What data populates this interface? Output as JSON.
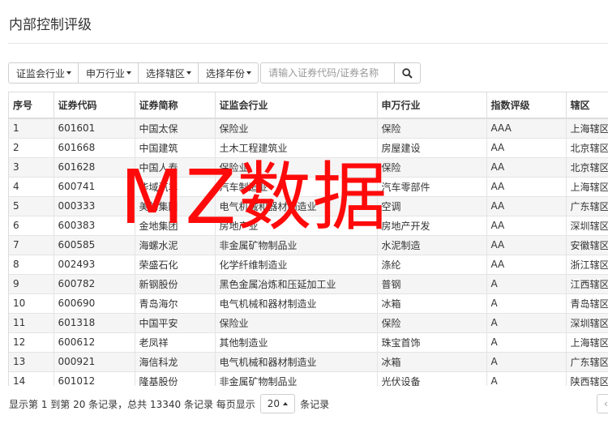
{
  "page": {
    "title": "内部控制评级"
  },
  "filters": [
    {
      "label": "证监会行业"
    },
    {
      "label": "申万行业"
    },
    {
      "label": "选择辖区"
    },
    {
      "label": "选择年份"
    }
  ],
  "search": {
    "placeholder": "请输入证券代码/证券名称",
    "value": ""
  },
  "table": {
    "columns": [
      "序号",
      "证券代码",
      "证券简称",
      "证监会行业",
      "申万行业",
      "指数评级",
      "辖区"
    ],
    "rows": [
      [
        "1",
        "601601",
        "中国太保",
        "保险业",
        "保险",
        "AAA",
        "上海辖区"
      ],
      [
        "2",
        "601668",
        "中国建筑",
        "土木工程建筑业",
        "房屋建设",
        "AA",
        "北京辖区"
      ],
      [
        "3",
        "601628",
        "中国人寿",
        "保险业",
        "保险",
        "AA",
        "北京辖区"
      ],
      [
        "4",
        "600741",
        "华域汽车",
        "汽车制造业",
        "汽车零部件",
        "AA",
        "上海辖区"
      ],
      [
        "5",
        "000333",
        "美的集团",
        "电气机械和器材制造业",
        "空调",
        "AA",
        "广东辖区"
      ],
      [
        "6",
        "600383",
        "金地集团",
        "房地产业",
        "房地产开发",
        "AA",
        "深圳辖区"
      ],
      [
        "7",
        "600585",
        "海螺水泥",
        "非金属矿物制品业",
        "水泥制造",
        "AA",
        "安徽辖区"
      ],
      [
        "8",
        "002493",
        "荣盛石化",
        "化学纤维制造业",
        "涤纶",
        "AA",
        "浙江辖区"
      ],
      [
        "9",
        "600782",
        "新钢股份",
        "黑色金属冶炼和压延加工业",
        "普钢",
        "A",
        "江西辖区"
      ],
      [
        "10",
        "600690",
        "青岛海尔",
        "电气机械和器材制造业",
        "冰箱",
        "A",
        "青岛辖区"
      ],
      [
        "11",
        "601318",
        "中国平安",
        "保险业",
        "保险",
        "A",
        "深圳辖区"
      ],
      [
        "12",
        "600612",
        "老凤祥",
        "其他制造业",
        "珠宝首饰",
        "A",
        "上海辖区"
      ],
      [
        "13",
        "000921",
        "海信科龙",
        "电气机械和器材制造业",
        "冰箱",
        "A",
        "广东辖区"
      ],
      [
        "14",
        "601012",
        "隆基股份",
        "非金属矿物制品业",
        "光伏设备",
        "A",
        "陕西辖区"
      ]
    ]
  },
  "watermark": {
    "text": "MZ数据",
    "color": "#ff0a0a"
  },
  "footer": {
    "summary": "显示第 1 到第 20 条记录，总共 13340 条记录 每页显示",
    "page_size": "20",
    "suffix": "条记录"
  },
  "colors": {
    "border": "#dddddd",
    "stripe": "#f5f5f5",
    "watermark": "#ff0a0a"
  },
  "icons": {
    "search": "search-icon",
    "caret": "caret-down-icon"
  }
}
